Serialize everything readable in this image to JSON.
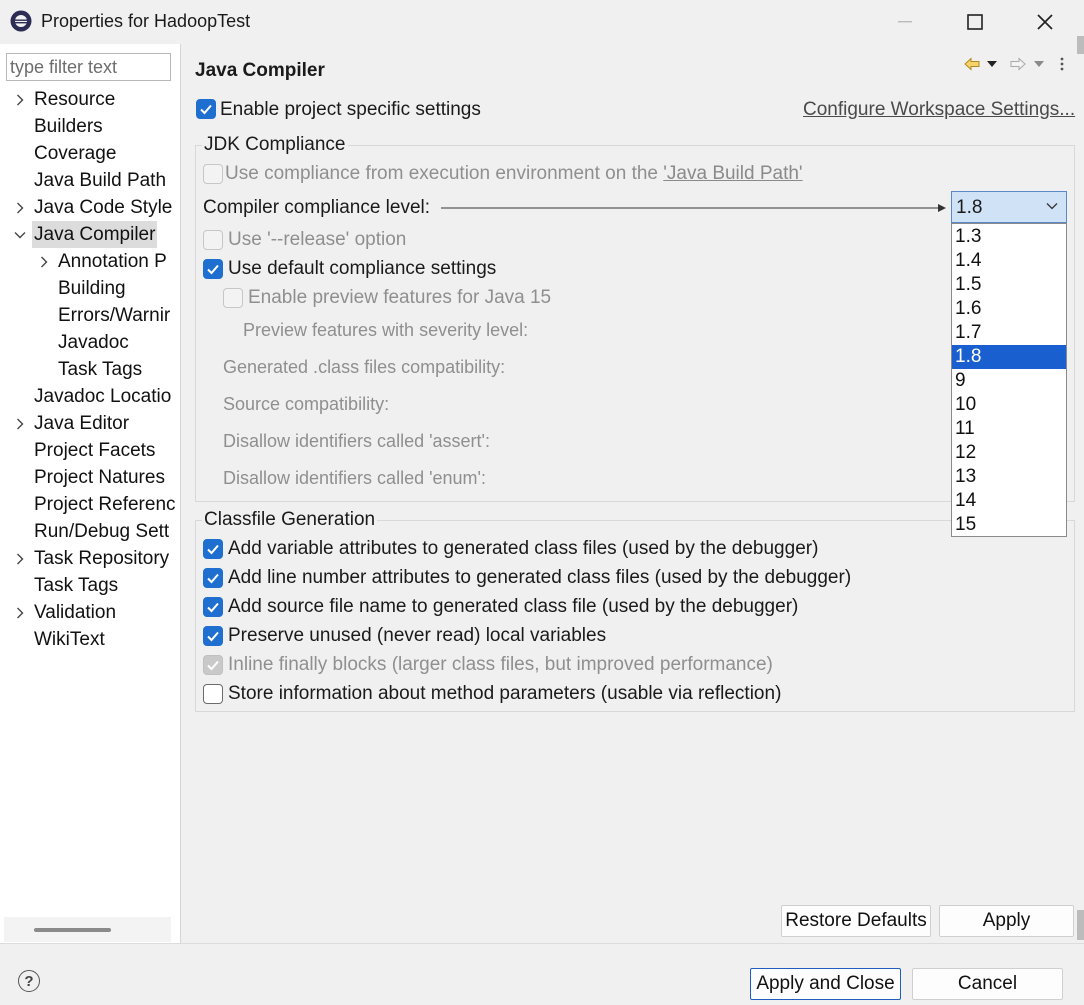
{
  "window": {
    "title": "Properties for HadoopTest"
  },
  "filter": {
    "placeholder": "type filter text"
  },
  "tree": [
    {
      "label": "Resource",
      "expandable": true,
      "expanded": false,
      "level": 0
    },
    {
      "label": "Builders",
      "expandable": false,
      "level": 0
    },
    {
      "label": "Coverage",
      "expandable": false,
      "level": 0
    },
    {
      "label": "Java Build Path",
      "expandable": false,
      "level": 0
    },
    {
      "label": "Java Code Style",
      "expandable": true,
      "expanded": false,
      "level": 0
    },
    {
      "label": "Java Compiler",
      "expandable": true,
      "expanded": true,
      "level": 0,
      "selected": true
    },
    {
      "label": "Annotation P",
      "expandable": true,
      "expanded": false,
      "level": 1
    },
    {
      "label": "Building",
      "expandable": false,
      "level": 1
    },
    {
      "label": "Errors/Warnir",
      "expandable": false,
      "level": 1
    },
    {
      "label": "Javadoc",
      "expandable": false,
      "level": 1
    },
    {
      "label": "Task Tags",
      "expandable": false,
      "level": 1
    },
    {
      "label": "Javadoc Locatio",
      "expandable": false,
      "level": 0
    },
    {
      "label": "Java Editor",
      "expandable": true,
      "expanded": false,
      "level": 0
    },
    {
      "label": "Project Facets",
      "expandable": false,
      "level": 0
    },
    {
      "label": "Project Natures",
      "expandable": false,
      "level": 0
    },
    {
      "label": "Project Referenc",
      "expandable": false,
      "level": 0
    },
    {
      "label": "Run/Debug Sett",
      "expandable": false,
      "level": 0
    },
    {
      "label": "Task Repository",
      "expandable": true,
      "expanded": false,
      "level": 0
    },
    {
      "label": "Task Tags",
      "expandable": false,
      "level": 0
    },
    {
      "label": "Validation",
      "expandable": true,
      "expanded": false,
      "level": 0
    },
    {
      "label": "WikiText",
      "expandable": false,
      "level": 0
    }
  ],
  "page": {
    "title": "Java Compiler",
    "enable_specific": {
      "label": "Enable project specific settings",
      "checked": true
    },
    "configure_link": "Configure Workspace Settings...",
    "jdk": {
      "group_label": "JDK Compliance",
      "use_env_prefix": "Use compliance from execution environment on the ",
      "use_env_link": "'Java Build Path'",
      "level_label": "Compiler compliance level:",
      "level_value": "1.8",
      "options": [
        "1.3",
        "1.4",
        "1.5",
        "1.6",
        "1.7",
        "1.8",
        "9",
        "10",
        "11",
        "12",
        "13",
        "14",
        "15"
      ],
      "selected_option": "1.8",
      "release_label": "Use '--release' option",
      "default_label": "Use default compliance settings",
      "preview_label": "Enable preview features for Java 15",
      "severity_label": "Preview features with severity level:",
      "generated_label": "Generated .class files compatibility:",
      "source_label": "Source compatibility:",
      "assert_label": "Disallow identifiers called 'assert':",
      "enum_label": "Disallow identifiers called 'enum':"
    },
    "classfile": {
      "group_label": "Classfile Generation",
      "items": [
        {
          "label": "Add variable attributes to generated class files (used by the debugger)",
          "checked": true,
          "enabled": true
        },
        {
          "label": "Add line number attributes to generated class files (used by the debugger)",
          "checked": true,
          "enabled": true
        },
        {
          "label": "Add source file name to generated class file (used by the debugger)",
          "checked": true,
          "enabled": true
        },
        {
          "label": "Preserve unused (never read) local variables",
          "checked": true,
          "enabled": true
        },
        {
          "label": "Inline finally blocks (larger class files, but improved performance)",
          "checked": true,
          "enabled": false
        },
        {
          "label": "Store information about method parameters (usable via reflection)",
          "checked": false,
          "enabled": true
        }
      ]
    },
    "restore_label": "Restore Defaults",
    "apply_label": "Apply"
  },
  "footer": {
    "help": "?",
    "apply_close_label": "Apply and Close",
    "cancel_label": "Cancel"
  },
  "colors": {
    "accent": "#1f6fd1",
    "selection": "#1a5fd0",
    "combo_bg": "#cfe2f6"
  },
  "icons": [
    "eclipse-app-icon",
    "minimize-icon",
    "maximize-icon",
    "close-icon",
    "back-arrow-icon",
    "forward-arrow-icon",
    "view-menu-icon",
    "help-icon",
    "chevron-right-icon",
    "chevron-down-icon",
    "check-icon"
  ]
}
